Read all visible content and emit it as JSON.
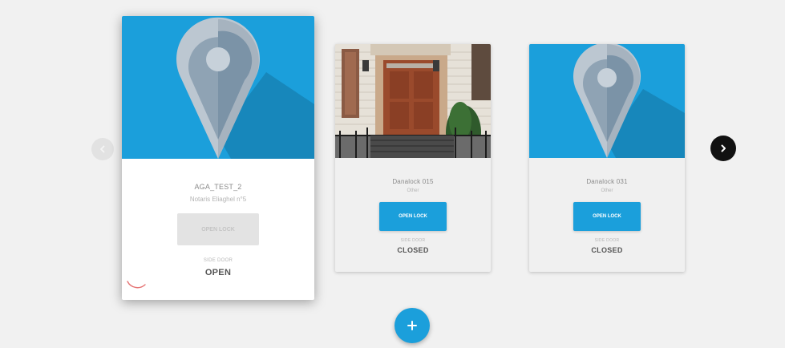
{
  "carousel": {
    "prev_icon": "chevron-left-icon",
    "next_icon": "chevron-right-icon",
    "add_icon": "plus-icon"
  },
  "colors": {
    "accent": "#1b9fdb",
    "pin_tile": "#1b9fdb",
    "next_arrow": "#111111",
    "disabled_button": "#e3e3e3"
  },
  "cards": [
    {
      "media": "pin-illustration",
      "title": "AGA_TEST_2",
      "subtitle": "Notaris Eliaghel n°5",
      "button_label": "OPEN LOCK",
      "button_state": "disabled",
      "status_label": "SIDE DOOR",
      "status_value": "OPEN",
      "loading": true
    },
    {
      "media": "door-photo",
      "title": "Danalock 015",
      "subtitle": "Other",
      "button_label": "OPEN LOCK",
      "button_state": "enabled",
      "status_label": "SIDE DOOR",
      "status_value": "CLOSED"
    },
    {
      "media": "pin-illustration",
      "title": "Danalock 031",
      "subtitle": "Other",
      "button_label": "OPEN LOCK",
      "button_state": "enabled",
      "status_label": "SIDE DOOR",
      "status_value": "CLOSED"
    }
  ]
}
